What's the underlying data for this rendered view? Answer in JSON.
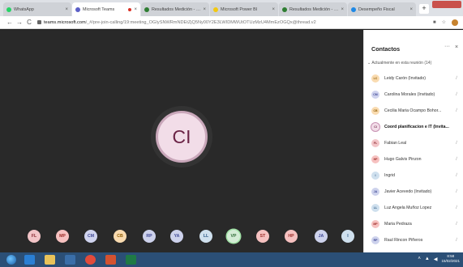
{
  "browser": {
    "tabs": [
      {
        "label": "WhatsApp",
        "color": "#25d366",
        "active": false,
        "recording": false
      },
      {
        "label": "Microsoft Teams",
        "color": "#5b5fc7",
        "active": true,
        "recording": true
      },
      {
        "label": "Resultados Medición - …",
        "color": "#2e7d32",
        "active": false,
        "recording": false
      },
      {
        "label": "Microsoft Power BI",
        "color": "#f2c811",
        "active": false,
        "recording": false
      },
      {
        "label": "Resultados Medición - …",
        "color": "#2e7d32",
        "active": false,
        "recording": false
      },
      {
        "label": "Desempeño Fiscal",
        "color": "#1e88e5",
        "active": false,
        "recording": false
      }
    ],
    "new_tab": "+",
    "address": {
      "host": "teams.microsoft.com",
      "path": "/_#/pre-join-calling/19:meeting_OGIySNWRmNDEtZjQ5Ny00Y2E3LWIDMWUtOTUzMzU4MmEzOGQx@thread.v2"
    }
  },
  "meeting": {
    "speaker_initials": "CI",
    "speaker_color": "#6b2446",
    "participant_bubbles": [
      {
        "initials": "FL",
        "bg": "#f2c4c7",
        "fg": "#8a2a32"
      },
      {
        "initials": "MP",
        "bg": "#f6c1c0",
        "fg": "#9b2b26"
      },
      {
        "initials": "CM",
        "bg": "#cfd3ee",
        "fg": "#3e4794"
      },
      {
        "initials": "CB",
        "bg": "#f9dbb0",
        "fg": "#8d5a00"
      },
      {
        "initials": "RP",
        "bg": "#cdd2ec",
        "fg": "#3e4794"
      },
      {
        "initials": "YA",
        "bg": "#cdd2ec",
        "fg": "#3e4794"
      },
      {
        "initials": "LL",
        "bg": "#cfe0ee",
        "fg": "#2e5a85"
      },
      {
        "initials": "VP",
        "bg": "#d3ecd5",
        "fg": "#2f6b36",
        "selected": true
      },
      {
        "initials": "ST",
        "bg": "#f6c1c0",
        "fg": "#9b2b26"
      },
      {
        "initials": "HP",
        "bg": "#f6c1c0",
        "fg": "#9b2b26"
      },
      {
        "initials": "JA",
        "bg": "#cdd2ec",
        "fg": "#3e4794"
      },
      {
        "initials": "I",
        "bg": "#cfe0ee",
        "fg": "#2e5a85"
      }
    ]
  },
  "contacts": {
    "title": "Contactos",
    "more": "···",
    "close": "×",
    "section_label": "Actualmente en esta reunión (14)",
    "participants": [
      {
        "initials": "LC",
        "name": "Leidy Carón (Invitado)",
        "bg": "#f9dbb0",
        "fg": "#8d5a00"
      },
      {
        "initials": "CM",
        "name": "Carolina Morales (Invitado)",
        "bg": "#cfd3ee",
        "fg": "#3e4794"
      },
      {
        "initials": "CB",
        "name": "Cecilia Maria Ocampo Bohor...",
        "bg": "#f9dbb0",
        "fg": "#8d5a00"
      },
      {
        "initials": "CI",
        "name": "Coord planificacion e IT (Invita...",
        "bg": "#f2dde8",
        "fg": "#6b2446",
        "current": true
      },
      {
        "initials": "FL",
        "name": "Fabian Leal",
        "bg": "#f2c4c7",
        "fg": "#8a2a32"
      },
      {
        "initials": "HP",
        "name": "Hugo Galvis Pinzon",
        "bg": "#f6c1c0",
        "fg": "#9b2b26"
      },
      {
        "initials": "I",
        "name": "Ingrid",
        "bg": "#cfe0ee",
        "fg": "#2e5a85"
      },
      {
        "initials": "JA",
        "name": "Javier Acevedo (Invitado)",
        "bg": "#cdd2ec",
        "fg": "#3e4794"
      },
      {
        "initials": "LL",
        "name": "Luz Angela Muñoz Lopez",
        "bg": "#cfe0ee",
        "fg": "#2e5a85"
      },
      {
        "initials": "MP",
        "name": "Maria Pedraza",
        "bg": "#f6c1c0",
        "fg": "#9b2b26"
      },
      {
        "initials": "RP",
        "name": "Raul Rincon Piñeros",
        "bg": "#cdd2ec",
        "fg": "#3e4794"
      }
    ]
  },
  "taskbar": {
    "apps": [
      {
        "name": "edge-icon",
        "color": "#2a7fd4"
      },
      {
        "name": "file-explorer-icon",
        "color": "#e8c25a"
      },
      {
        "name": "media-player-icon",
        "color": "#3a6ea8"
      },
      {
        "name": "chrome-icon",
        "color": "#e24b3b"
      },
      {
        "name": "powerpoint-icon",
        "color": "#d35230"
      },
      {
        "name": "excel-icon",
        "color": "#1f7a45"
      }
    ],
    "clock_time": "8:58",
    "clock_date": "15/02/2021"
  }
}
